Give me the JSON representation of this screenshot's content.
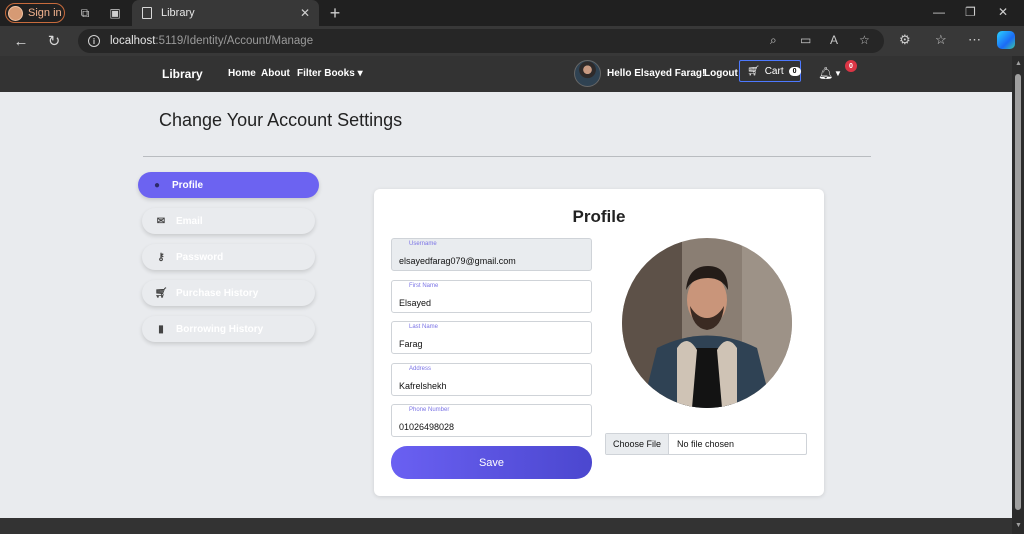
{
  "browser": {
    "signin_label": "Sign in",
    "tab_title": "Library",
    "tab_close": "✕",
    "new_tab": "+",
    "url_host": "localhost",
    "url_rest": ":5119/Identity/Account/Manage"
  },
  "navbar": {
    "brand": "Library",
    "home": "Home",
    "about": "About",
    "filter_books": "Filter Books ▾",
    "greeting": "Hello Elsayed Farag!",
    "logout": "Logout",
    "cart_label": "Cart",
    "cart_count": "0",
    "notifications_count": "0"
  },
  "page": {
    "heading": "Change Your Account Settings"
  },
  "sidebar": {
    "items": [
      {
        "label": "Profile",
        "icon": "user-circle-icon",
        "active": true
      },
      {
        "label": "Email",
        "icon": "envelope-icon",
        "active": false
      },
      {
        "label": "Password",
        "icon": "key-icon",
        "active": false
      },
      {
        "label": "Purchase History",
        "icon": "cart-icon",
        "active": false
      },
      {
        "label": "Borrowing History",
        "icon": "book-icon",
        "active": false
      }
    ]
  },
  "profile": {
    "title": "Profile",
    "fields": [
      {
        "label": "Username",
        "value": "elsayedfarag079@gmail.com",
        "readonly": true
      },
      {
        "label": "First Name",
        "value": "Elsayed"
      },
      {
        "label": "Last Name",
        "value": "Farag"
      },
      {
        "label": "Address",
        "value": "Kafrelshekh"
      },
      {
        "label": "Phone Number",
        "value": "01026498028"
      }
    ],
    "save_label": "Save",
    "choose_file_label": "Choose File",
    "no_file_label": "No file chosen"
  },
  "colors": {
    "accent": "#6c63f1",
    "navbar": "#333333",
    "page_bg": "#e9ebee",
    "badge": "#dc3545"
  }
}
